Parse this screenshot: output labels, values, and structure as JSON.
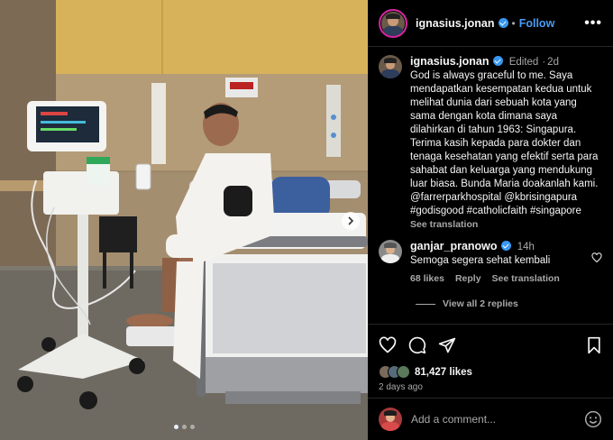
{
  "post": {
    "username": "ignasius.jonan",
    "follow_label": "Follow",
    "more_label": "•••",
    "edited_label": "Edited",
    "time_ago": "2d",
    "caption": "God is always graceful to me. Saya mendapatkan kesempatan kedua untuk melihat dunia dari sebuah kota yang sama dengan kota dimana saya dilahirkan di tahun 1963: Singapura. Terima kasih kepada para dokter dan tenaga kesehatan yang efektif serta para sahabat dan keluarga yang mendukung luar biasa. Bunda Maria doakanlah kami. @farrerparkhospital @kbrisingapura #godisgood #catholicfaith #singapore",
    "see_translation": "See translation"
  },
  "comment": {
    "username": "ganjar_pranowo",
    "time_ago": "14h",
    "text": "Semoga segera sehat kembali",
    "likes": "68 likes",
    "reply_label": "Reply",
    "see_translation": "See translation",
    "view_replies": "View all 2 replies"
  },
  "stats": {
    "likes": "81,427 likes",
    "posted": "2 days ago"
  },
  "composer": {
    "placeholder": "Add a comment..."
  },
  "carousel": {
    "slide_count": 3,
    "active_slide": 1
  },
  "colors": {
    "accent": "#4a9cf5",
    "verified": "#3897f0",
    "muted_text": "#a8a8a8",
    "background": "#000000"
  },
  "icons": [
    "verified-badge-icon",
    "more-options-icon",
    "heart-icon",
    "comment-icon",
    "share-icon",
    "bookmark-icon",
    "emoji-icon",
    "next-arrow-icon"
  ]
}
